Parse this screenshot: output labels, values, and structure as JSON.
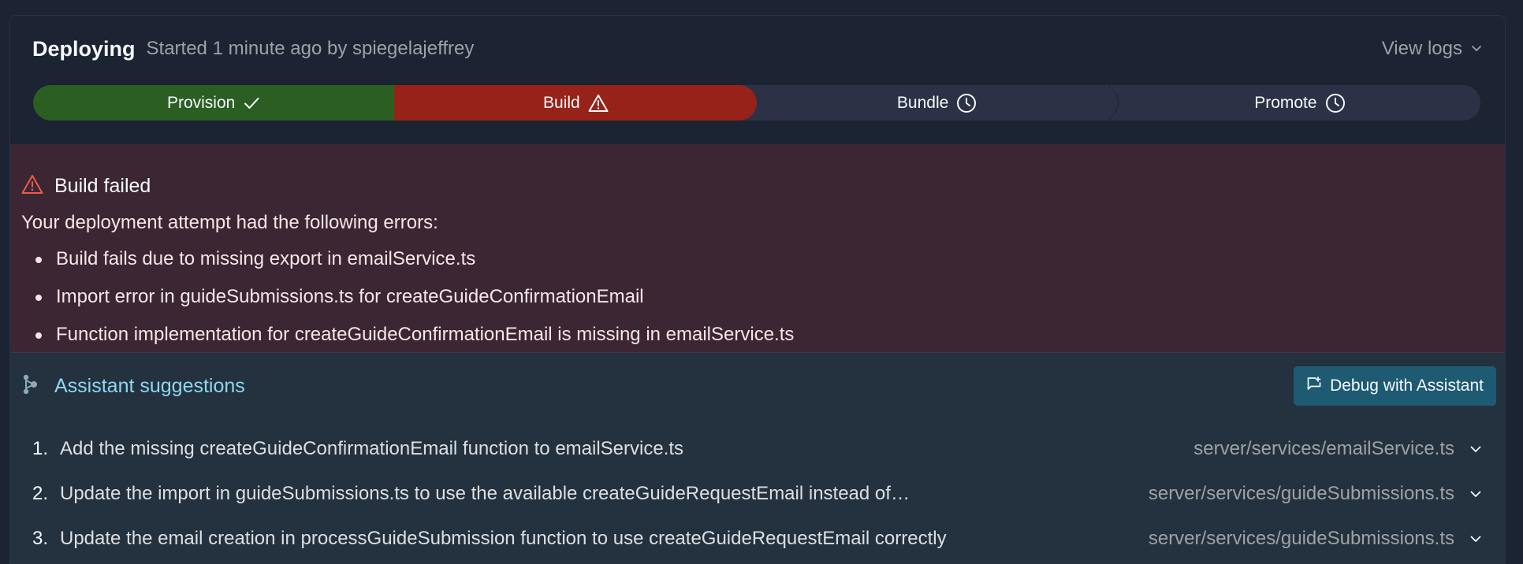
{
  "header": {
    "title": "Deploying",
    "subtitle": "Started 1 minute ago by spiegelajeffrey",
    "view_logs_label": "View logs"
  },
  "steps": [
    {
      "label": "Provision",
      "status": "success",
      "icon": "check-icon"
    },
    {
      "label": "Build",
      "status": "failed",
      "icon": "warning-icon"
    },
    {
      "label": "Bundle",
      "status": "pending",
      "icon": "clock-icon"
    },
    {
      "label": "Promote",
      "status": "pending",
      "icon": "clock-icon"
    }
  ],
  "error": {
    "title": "Build failed",
    "intro": "Your deployment attempt had the following errors:",
    "items": [
      "Build fails due to missing export in emailService.ts",
      "Import error in guideSubmissions.ts for createGuideConfirmationEmail",
      "Function implementation for createGuideConfirmationEmail is missing in emailService.ts"
    ]
  },
  "assistant": {
    "title": "Assistant suggestions",
    "debug_button_label": "Debug with Assistant",
    "suggestions": [
      {
        "num": "1.",
        "text": "Add the missing createGuideConfirmationEmail function to emailService.ts",
        "path": "server/services/emailService.ts"
      },
      {
        "num": "2.",
        "text": "Update the import in guideSubmissions.ts to use the available createGuideRequestEmail instead of…",
        "path": "server/services/guideSubmissions.ts"
      },
      {
        "num": "3.",
        "text": "Update the email creation in processGuideSubmission function to use createGuideRequestEmail correctly",
        "path": "server/services/guideSubmissions.ts"
      }
    ]
  },
  "colors": {
    "success": "#2b5e22",
    "failed": "#962219",
    "pending": "#2b3245",
    "error_bg": "#3c2633",
    "assistant_bg": "#24323f",
    "assistant_accent": "#8fd6f0",
    "debug_button_bg": "#1e5a72"
  }
}
